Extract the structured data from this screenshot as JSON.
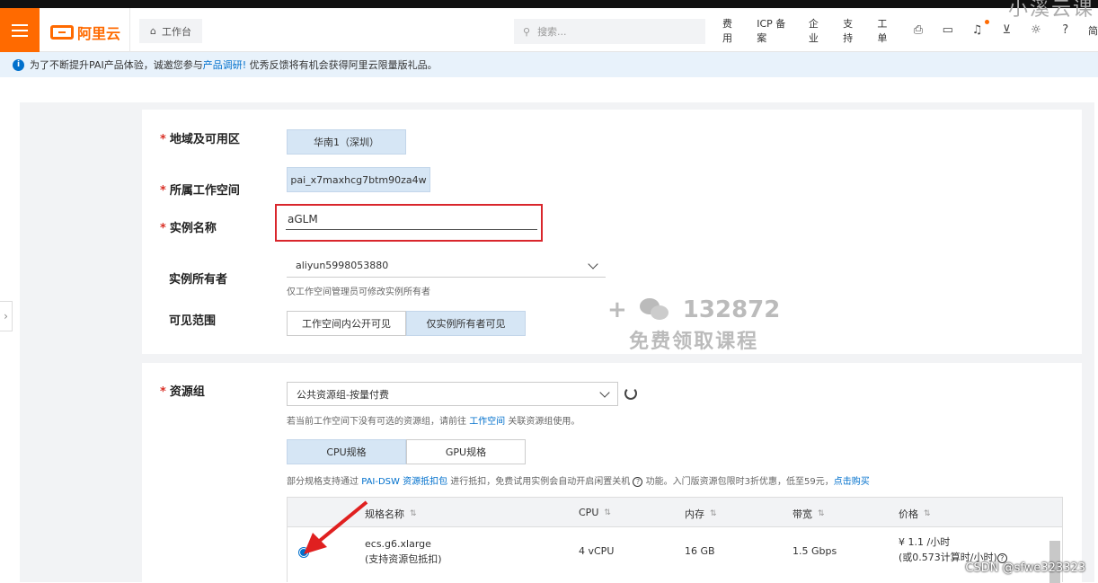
{
  "header": {
    "logo_text": "阿里云",
    "workbench_label": "工作台",
    "search_placeholder": "搜索...",
    "nav": [
      "费用",
      "ICP 备案",
      "企业",
      "支持",
      "工单"
    ],
    "nav_trailing": "简",
    "brand_color": "#ff6a00"
  },
  "notice": {
    "prefix": "为了不断提升PAI产品体验，诚邀您参与",
    "link": "产品调研!",
    "suffix": " 优秀反馈将有机会获得阿里云限量版礼品。"
  },
  "form": {
    "region_label": "地域及可用区",
    "region_value": "华南1（深圳）",
    "workspace_label": "所属工作空间",
    "workspace_value": "pai_x7maxhcg7btm90za4w",
    "instance_name_label": "实例名称",
    "instance_name_value": "aGLM",
    "owner_label": "实例所有者",
    "owner_value": "aliyun5998053880",
    "owner_hint": "仅工作空间管理员可修改实例所有者",
    "visibility_label": "可见范围",
    "visibility_options": [
      "工作空间内公开可见",
      "仅实例所有者可见"
    ],
    "visibility_selected": 1,
    "resource_group_label": "资源组",
    "resource_group_value": "公共资源组-按量付费",
    "resource_hint_prefix": "若当前工作空间下没有可选的资源组，请前往 ",
    "resource_hint_link": "工作空间",
    "resource_hint_suffix": " 关联资源组使用。",
    "spec_tabs": [
      "CPU规格",
      "GPU规格"
    ],
    "spec_tab_selected": 0,
    "spec_note_prefix": "部分规格支持通过 ",
    "spec_note_link": "PAI-DSW 资源抵扣包",
    "spec_note_mid": " 进行抵扣，免费试用实例会自动开启闲置关机 ",
    "spec_note_suffix": " 功能。入门版资源包限时3折优惠，低至59元，",
    "spec_note_buy": "点击购买"
  },
  "promo": {
    "line1": "132872",
    "line2": "免费领取课程"
  },
  "table": {
    "columns": [
      "规格名称",
      "CPU",
      "内存",
      "带宽",
      "价格"
    ],
    "rows": [
      {
        "name": "ecs.g6.xlarge",
        "name_sub": "(支持资源包抵扣)",
        "cpu": "4 vCPU",
        "memory": "16 GB",
        "bandwidth": "1.5 Gbps",
        "price": "¥ 1.1 /小时",
        "price_sub": "(或0.573计算时/小时)",
        "selected": true
      }
    ]
  },
  "watermark": "CSDN @sfwe323323",
  "top_watermark": "小溪云课"
}
